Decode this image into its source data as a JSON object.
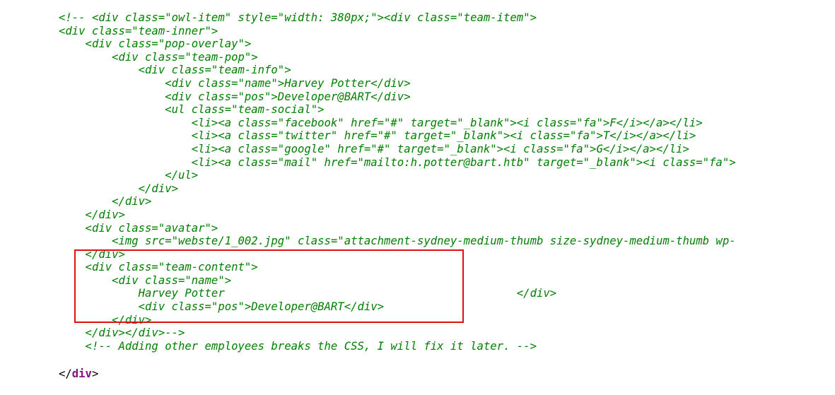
{
  "comment_block": [
    "<!-- <div class=\"owl-item\" style=\"width: 380px;\"><div class=\"team-item\">",
    "<div class=\"team-inner\">",
    "    <div class=\"pop-overlay\">",
    "        <div class=\"team-pop\">",
    "            <div class=\"team-info\">",
    "                <div class=\"name\">Harvey Potter</div>",
    "                <div class=\"pos\">Developer@BART</div>",
    "                <ul class=\"team-social\">",
    "                    <li><a class=\"facebook\" href=\"#\" target=\"_blank\"><i class=\"fa\">F</i></a></li>",
    "                    <li><a class=\"twitter\" href=\"#\" target=\"_blank\"><i class=\"fa\">T</i></a></li>",
    "                    <li><a class=\"google\" href=\"#\" target=\"_blank\"><i class=\"fa\">G</i></a></li>",
    "                    <li><a class=\"mail\" href=\"mailto:h.potter@bart.htb\" target=\"_blank\"><i class=\"fa\">",
    "                </ul>",
    "            </div>",
    "        </div>",
    "    </div>",
    "    <div class=\"avatar\">",
    "        <img src=\"webste/1_002.jpg\" class=\"attachment-sydney-medium-thumb size-sydney-medium-thumb wp-",
    "    </div>",
    "    <div class=\"team-content\">",
    "        <div class=\"name\">",
    "            Harvey Potter                                            </div>",
    "            <div class=\"pos\">Developer@BART</div>",
    "        </div>",
    "    </div></div>-->",
    "    <!-- Adding other employees breaks the CSS, I will fix it later. -->"
  ],
  "closing_tag": {
    "open": "</",
    "name": "div",
    "close": ">"
  },
  "colors": {
    "comment": "#008000",
    "tag_name": "#881280",
    "highlight": "#e01010"
  }
}
